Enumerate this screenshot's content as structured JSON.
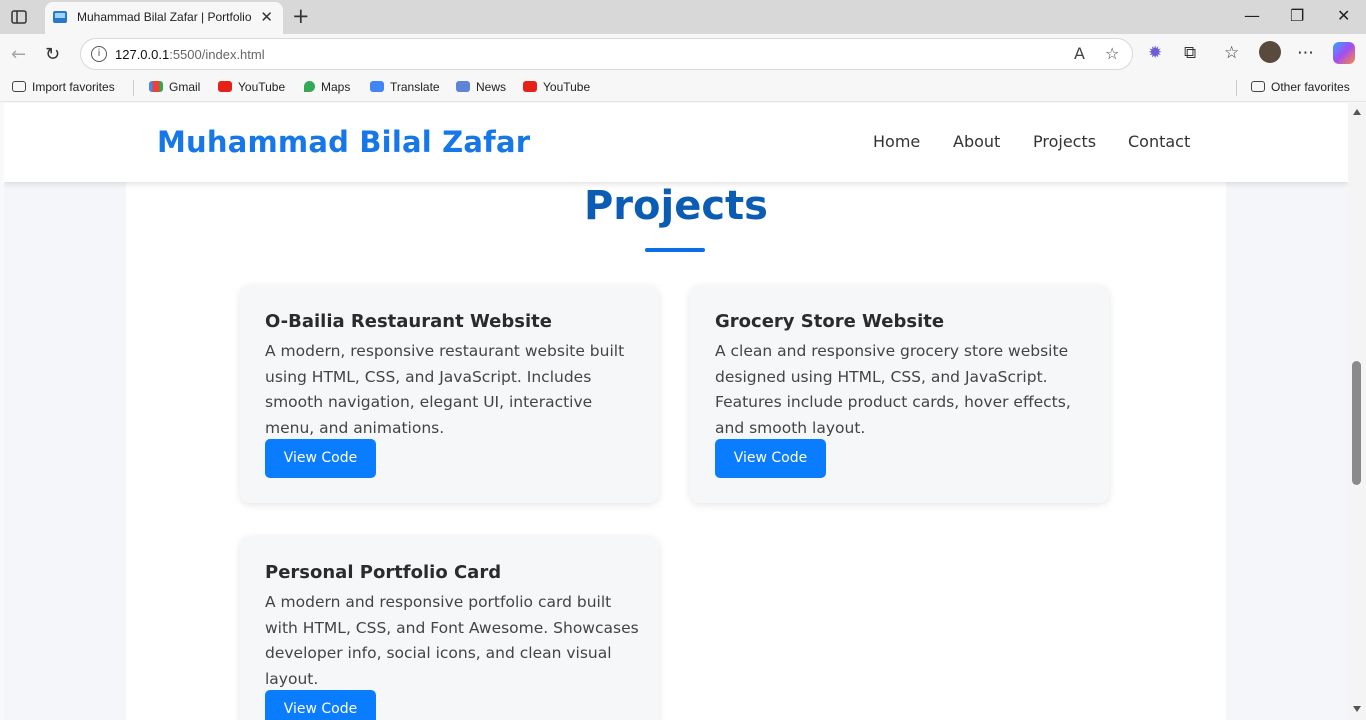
{
  "browser": {
    "tab_title": "Muhammad Bilal Zafar | Portfolio",
    "url_host": "127.0.0.1",
    "url_path": ":5500/index.html",
    "favorites": [
      {
        "label": "Import favorites",
        "icon": "import-icon"
      },
      {
        "label": "Gmail",
        "icon": "gmail-icon"
      },
      {
        "label": "YouTube",
        "icon": "youtube-icon"
      },
      {
        "label": "Maps",
        "icon": "maps-icon"
      },
      {
        "label": "Translate",
        "icon": "translate-icon"
      },
      {
        "label": "News",
        "icon": "news-icon"
      },
      {
        "label": "YouTube",
        "icon": "youtube-icon"
      }
    ],
    "other_favorites": "Other favorites"
  },
  "site": {
    "logo": "Muhammad Bilal Zafar",
    "nav": [
      "Home",
      "About",
      "Projects",
      "Contact"
    ],
    "accent_color": "#1677e8"
  },
  "projects": {
    "title": "Projects",
    "cards": [
      {
        "title": "O-Bailia Restaurant Website",
        "description": "A modern, responsive restaurant website built using HTML, CSS, and JavaScript. Includes smooth navigation, elegant UI, interactive menu, and animations.",
        "button": "View Code"
      },
      {
        "title": "Grocery Store Website",
        "description": "A clean and responsive grocery store website designed using HTML, CSS, and JavaScript. Features include product cards, hover effects, and smooth layout.",
        "button": "View Code"
      },
      {
        "title": "Personal Portfolio Card",
        "description": "A modern and responsive portfolio card built with HTML, CSS, and Font Awesome. Showcases developer info, social icons, and clean visual layout.",
        "button": "View Code"
      }
    ]
  }
}
